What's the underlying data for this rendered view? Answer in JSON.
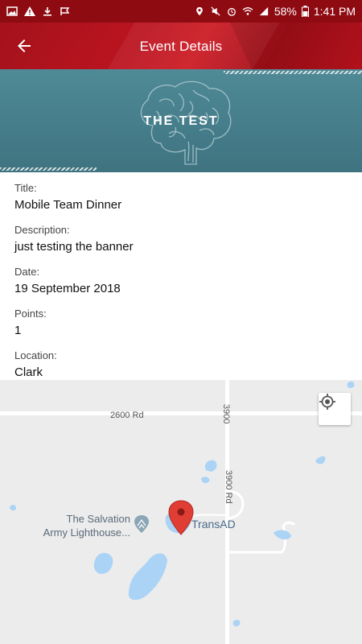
{
  "status_bar": {
    "battery": "58%",
    "time": "1:41 PM"
  },
  "app_bar": {
    "title": "Event Details",
    "back_icon": "arrow-left-icon"
  },
  "banner": {
    "text": "THE TEST",
    "icon": "brain-icon"
  },
  "details": {
    "fields": [
      {
        "label": "Title:",
        "value": "Mobile Team Dinner"
      },
      {
        "label": "Description:",
        "value": "just testing the banner"
      },
      {
        "label": "Date:",
        "value": "19 September 2018"
      },
      {
        "label": "Points:",
        "value": "1"
      },
      {
        "label": "Location:",
        "value": "Clark"
      }
    ]
  },
  "map": {
    "road_labels": {
      "road_2600": "2600 Rd",
      "road_3900": "3900",
      "road_3900_rd": "3900 Rd"
    },
    "poi": {
      "line1": "The Salvation",
      "line2": "Army Lighthouse..."
    },
    "marker_label": "TransAD",
    "locate_icon": "my-location-icon"
  }
}
